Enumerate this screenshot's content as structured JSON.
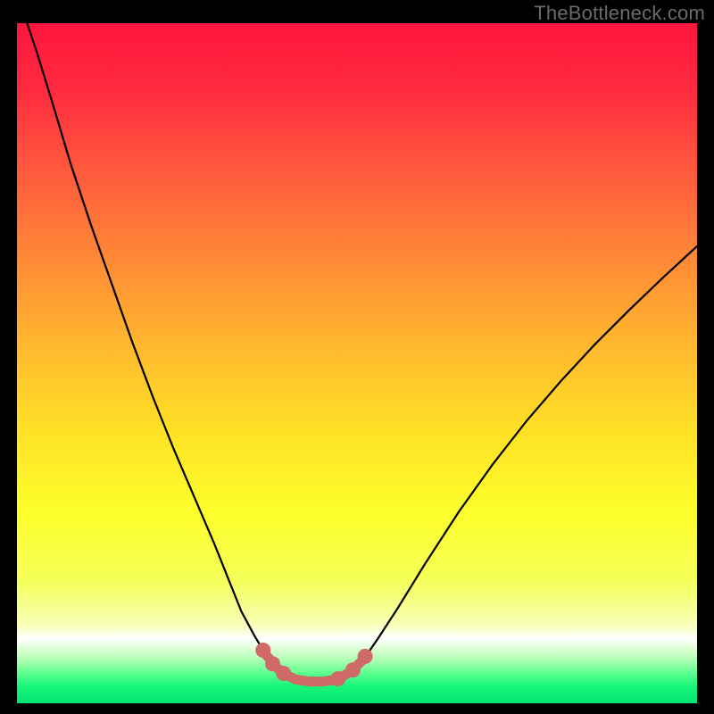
{
  "watermark": "TheBottleneck.com",
  "colors": {
    "black": "#000000",
    "trough_stroke": "#cf6a66",
    "gradient_stops": [
      {
        "offset": 0.0,
        "color": "#ff153e"
      },
      {
        "offset": 0.1,
        "color": "#ff2b3f"
      },
      {
        "offset": 0.22,
        "color": "#ff5a3d"
      },
      {
        "offset": 0.35,
        "color": "#ff8a36"
      },
      {
        "offset": 0.48,
        "color": "#ffba2e"
      },
      {
        "offset": 0.6,
        "color": "#ffe126"
      },
      {
        "offset": 0.72,
        "color": "#fcff2a"
      },
      {
        "offset": 0.82,
        "color": "#f5ff5a"
      },
      {
        "offset": 0.885,
        "color": "#f8ffb8"
      },
      {
        "offset": 0.905,
        "color": "#ffffff"
      },
      {
        "offset": 0.922,
        "color": "#d8ffcf"
      },
      {
        "offset": 0.938,
        "color": "#a8ffb0"
      },
      {
        "offset": 0.955,
        "color": "#5fff90"
      },
      {
        "offset": 0.975,
        "color": "#18f57a"
      },
      {
        "offset": 1.0,
        "color": "#00e574"
      }
    ]
  },
  "chart_data": {
    "type": "line",
    "title": "",
    "xlabel": "",
    "ylabel": "",
    "xlim": [
      0,
      100
    ],
    "ylim": [
      0,
      100
    ],
    "note": "V-shaped bottleneck curve. X is a relative balance axis (no ticks); Y is bottleneck percent with 0 at bottom, 100 at top. Values estimated from pixels.",
    "x": [
      1.5,
      3,
      5,
      8,
      11,
      14,
      17,
      20,
      23,
      26,
      29,
      31,
      33,
      35,
      36.5,
      38,
      39.5,
      41,
      43,
      45,
      47,
      49,
      51,
      53,
      56,
      60,
      65,
      70,
      75,
      80,
      85,
      90,
      95,
      100
    ],
    "y": [
      100,
      95.5,
      89,
      79,
      70,
      61.5,
      53,
      45,
      37.5,
      30.5,
      23.5,
      18.5,
      13.5,
      9.8,
      7.3,
      5.4,
      4.2,
      3.5,
      3.2,
      3.2,
      3.5,
      4.6,
      6.5,
      9.4,
      14,
      20.5,
      28.2,
      35.2,
      41.6,
      47.4,
      52.8,
      57.8,
      62.6,
      67.2
    ],
    "trough_segment": {
      "x": [
        36.5,
        38,
        39.5,
        41,
        43,
        45,
        47,
        49,
        51
      ],
      "y": [
        7.3,
        5.4,
        4.2,
        3.5,
        3.2,
        3.2,
        3.5,
        4.6,
        6.5
      ],
      "stroke_width_px": 11
    },
    "trough_markers": {
      "x": [
        36.2,
        37.6,
        39.2,
        47.2,
        49.4,
        51.2
      ],
      "y": [
        7.8,
        5.8,
        4.4,
        3.6,
        4.9,
        6.9
      ],
      "radius_px": 8.5
    }
  }
}
